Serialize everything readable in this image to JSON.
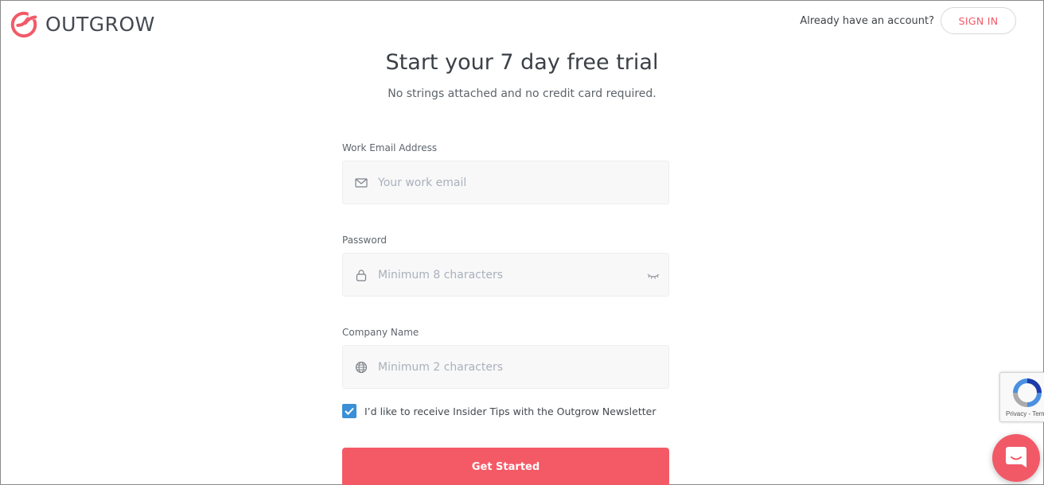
{
  "brand": {
    "name": "OUTGROW",
    "accent": "#f25967"
  },
  "header": {
    "account_prompt": "Already have an account?",
    "sign_in_label": "SIGN IN"
  },
  "hero": {
    "title": "Start your 7 day free trial",
    "subtitle": "No strings attached and no credit card required."
  },
  "form": {
    "email": {
      "label": "Work Email Address",
      "placeholder": "Your work email",
      "value": "",
      "icon": "envelope-icon"
    },
    "password": {
      "label": "Password",
      "placeholder": "Minimum 8 characters",
      "value": "",
      "icon": "lock-icon",
      "toggle_icon": "eye-hidden-icon"
    },
    "company": {
      "label": "Company Name",
      "placeholder": "Minimum 2 characters",
      "value": "",
      "icon": "globe-icon"
    },
    "newsletter": {
      "label": "I’d like to receive Insider Tips with the Outgrow Newsletter",
      "checked": true,
      "color": "#3a8fd6"
    },
    "submit_label": "Get Started",
    "submit_color": "#f45a66"
  },
  "recaptcha": {
    "footer_text": "Privacy - Terms"
  },
  "chat_widget": {
    "icon": "chat-bubble-icon"
  }
}
